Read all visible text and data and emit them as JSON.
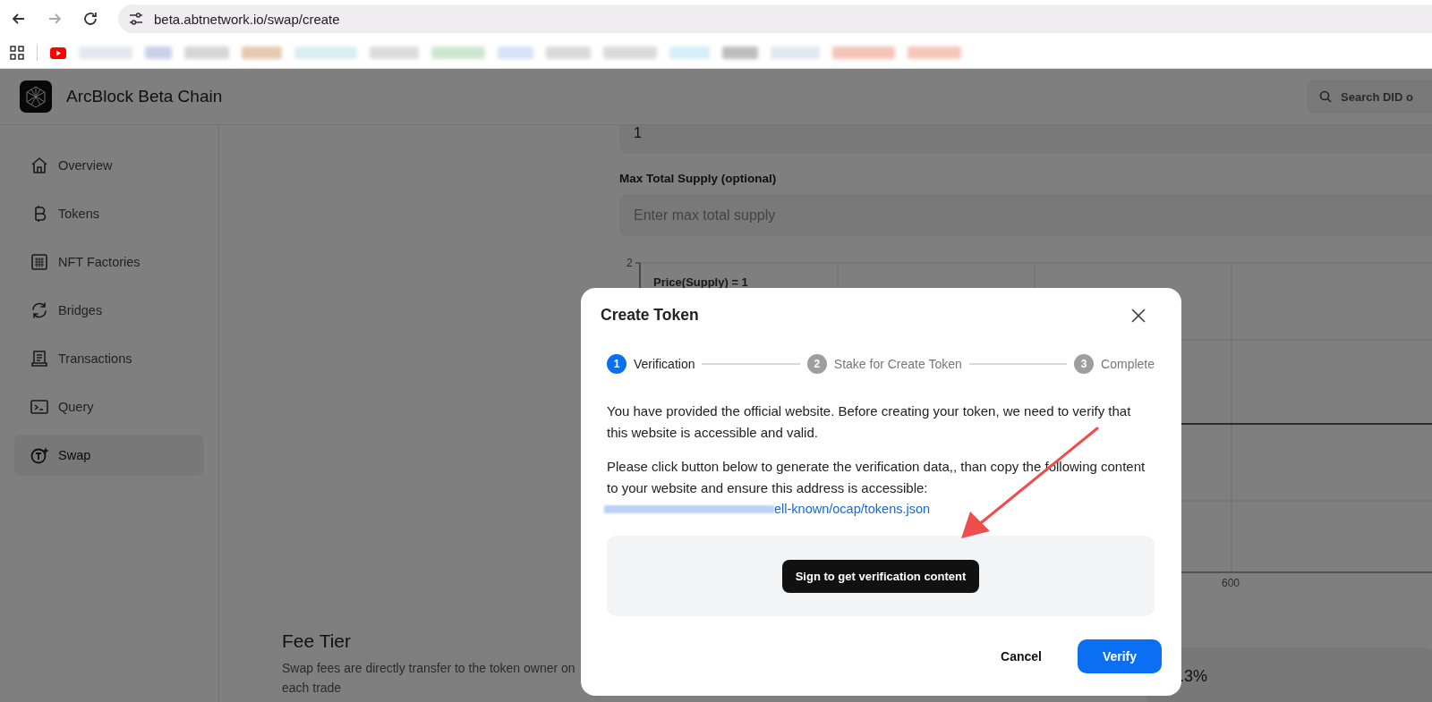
{
  "browser": {
    "url": "beta.abtnetwork.io/swap/create"
  },
  "app": {
    "title": "ArcBlock Beta Chain",
    "search_placeholder": "Search DID o"
  },
  "sidebar": {
    "items": [
      {
        "label": "Overview",
        "selected": false
      },
      {
        "label": "Tokens",
        "selected": false
      },
      {
        "label": "NFT Factories",
        "selected": false
      },
      {
        "label": "Bridges",
        "selected": false
      },
      {
        "label": "Transactions",
        "selected": false
      },
      {
        "label": "Query",
        "selected": false
      },
      {
        "label": "Swap",
        "selected": true
      }
    ]
  },
  "form": {
    "supply_value": "1",
    "max_supply_label": "Max Total Supply (optional)",
    "max_supply_placeholder": "Enter max total supply"
  },
  "chart": {
    "formula": "Price(Supply) = 1",
    "y_tick": "2",
    "x_tick": "600"
  },
  "fee_tier": {
    "title": "Fee Tier",
    "description": "Swap fees are directly transfer to the token owner on each trade",
    "option": ".3%"
  },
  "dialog": {
    "title": "Create Token",
    "steps": [
      {
        "number": "1",
        "label": "Verification",
        "selected": true
      },
      {
        "number": "2",
        "label": "Stake for Create Token",
        "selected": false
      },
      {
        "number": "3",
        "label": "Complete",
        "selected": false
      }
    ],
    "paragraphs": [
      "You have provided the official website. Before creating your token, we need to verify that this website is accessible and valid.",
      "Please click button below to generate the verification data,, than copy the following content to your website and ensure this address is accessible:"
    ],
    "link": "ell-known/ocap/tokens.json",
    "sign_button": "Sign to get verification content",
    "cancel_button": "Cancel",
    "verify_button": "Verify"
  }
}
